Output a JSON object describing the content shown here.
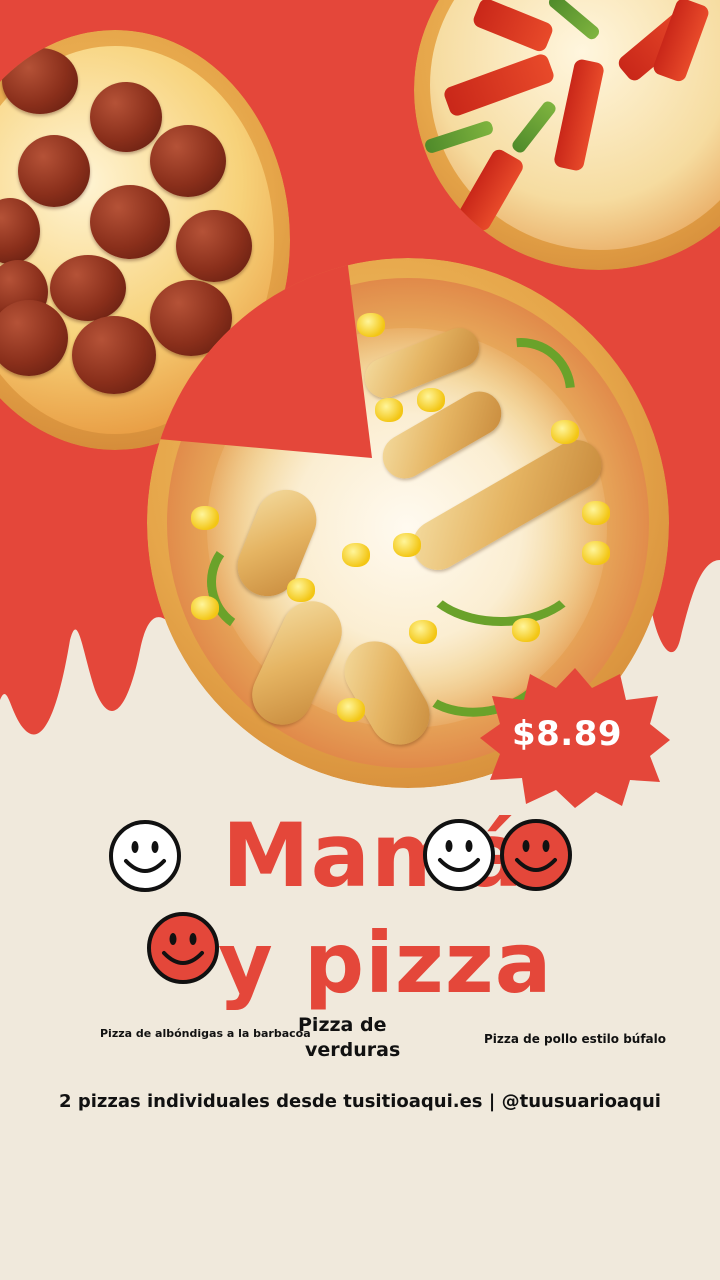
{
  "colors": {
    "background_cream": "#f0e9dc",
    "brand_red": "#e4473a",
    "text_dark": "#111111",
    "badge_text": "#ffffff"
  },
  "images": {
    "pizza_meatball": "meatball-bbq-pizza-photo",
    "pizza_vegetable": "vegetable-pizza-photo",
    "pizza_chicken": "buffalo-chicken-pizza-photo"
  },
  "price": "$8.89",
  "title": {
    "line1": "Mamá",
    "line2": "y pizza"
  },
  "labels": {
    "left": "Pizza de albóndigas a la barbacoa",
    "middle_line1": "Pizza de",
    "middle_line2": "verduras",
    "right": "Pizza de pollo estilo búfalo"
  },
  "footer": "2 pizzas individuales desde tusitioaqui.es | @tuusuarioaqui",
  "icons": {
    "smiley_outline": "smiley-face-icon",
    "smiley_red": "smiley-face-icon"
  }
}
